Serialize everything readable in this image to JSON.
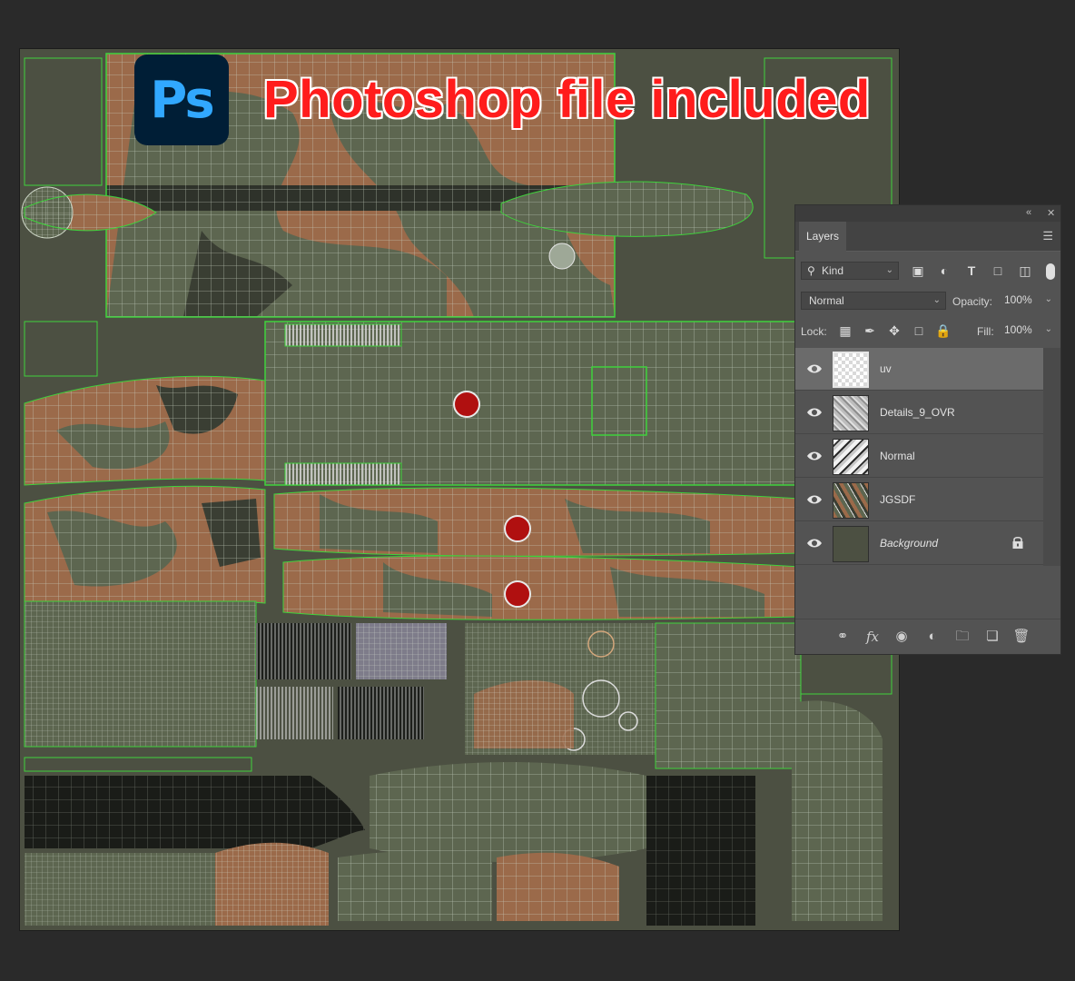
{
  "headline": "Photoshop file included",
  "ps_logo_text": "Ps",
  "colors": {
    "canvas_bg": "#4c5042",
    "camo_tan": "#9b6a4a",
    "camo_green": "#5d6650",
    "camo_dark": "#3a3e33",
    "wire": "#cfd8c8",
    "uv_edge": "#3fd23c",
    "roundel": "#b01010",
    "headline": "#ff1c1c",
    "ps_blue": "#31a8ff",
    "ps_navy": "#001e36"
  },
  "panel": {
    "tab_label": "Layers",
    "filter_label": "Kind",
    "blend_mode": "Normal",
    "opacity_label": "Opacity:",
    "opacity_value": "100%",
    "lock_label": "Lock:",
    "fill_label": "Fill:",
    "fill_value": "100%",
    "layers": [
      {
        "name": "uv",
        "selected": true,
        "visible": true,
        "italic": false,
        "locked": false
      },
      {
        "name": "Details_9_OVR",
        "selected": false,
        "visible": true,
        "italic": false,
        "locked": false
      },
      {
        "name": "Normal",
        "selected": false,
        "visible": true,
        "italic": false,
        "locked": false
      },
      {
        "name": "JGSDF",
        "selected": false,
        "visible": true,
        "italic": false,
        "locked": false
      },
      {
        "name": "Background",
        "selected": false,
        "visible": true,
        "italic": true,
        "locked": true
      }
    ],
    "bottom_icons": [
      "link-icon",
      "fx-icon",
      "mask-icon",
      "adjustment-icon",
      "folder-icon",
      "new-layer-icon",
      "trash-icon"
    ],
    "fx_label": "fx"
  }
}
